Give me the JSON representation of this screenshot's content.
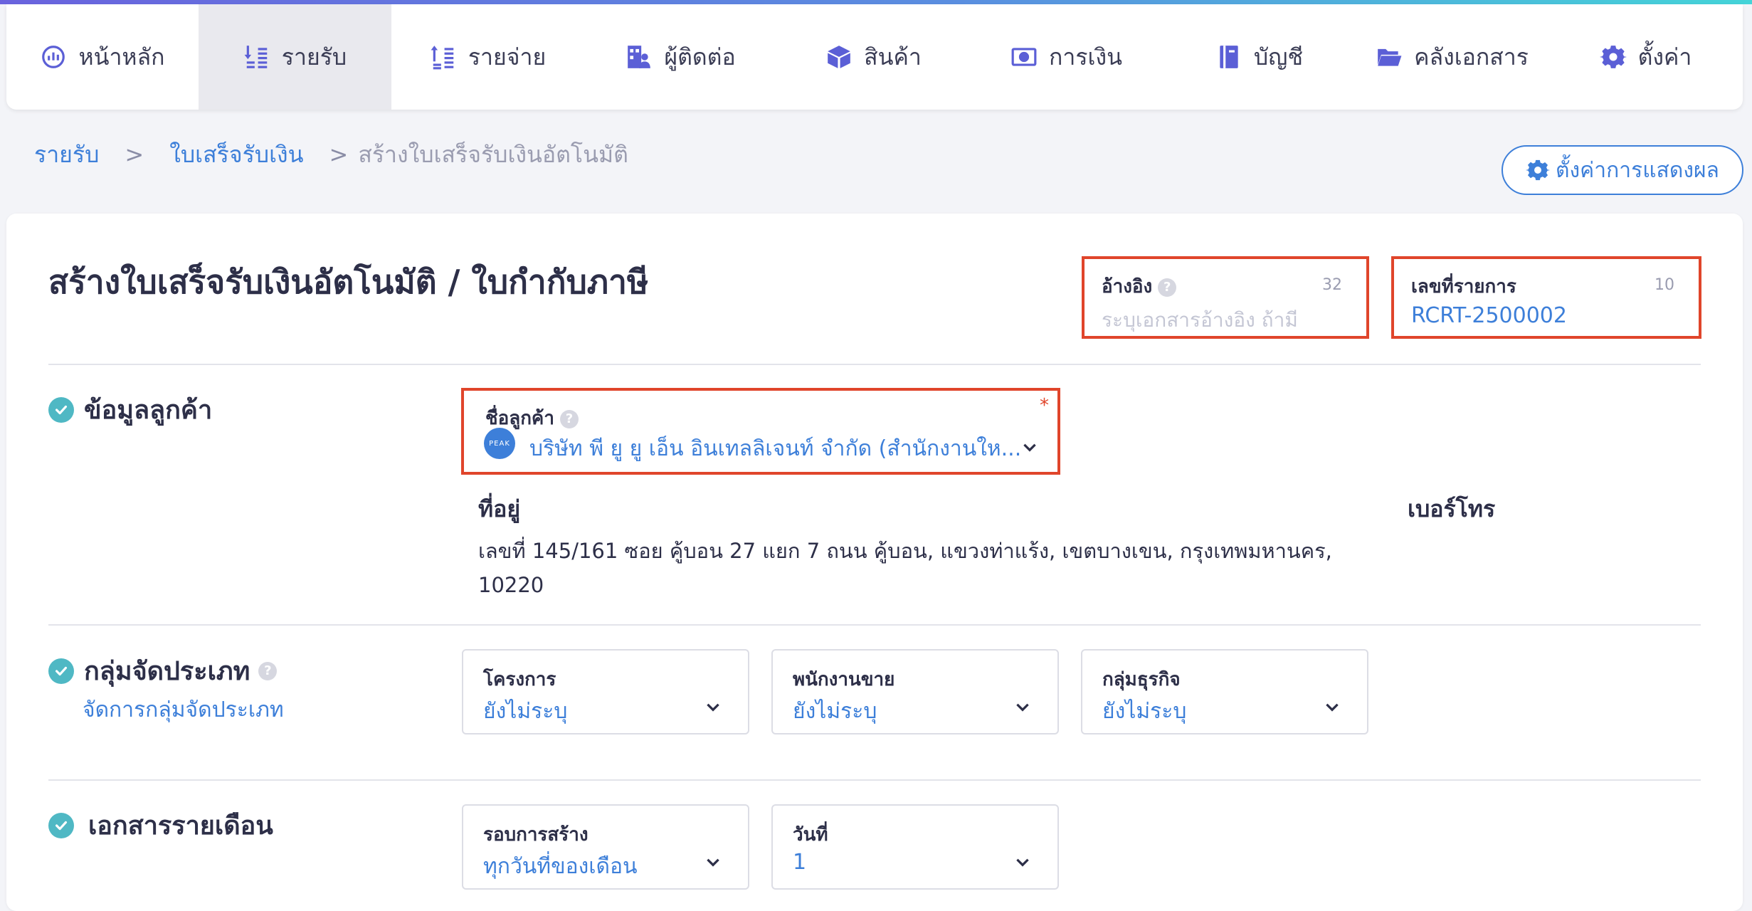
{
  "nav": {
    "items": [
      {
        "label": "หน้าหลัก",
        "icon": "dashboard-icon"
      },
      {
        "label": "รายรับ",
        "icon": "income-icon",
        "active": true
      },
      {
        "label": "รายจ่าย",
        "icon": "expense-icon"
      },
      {
        "label": "ผู้ติดต่อ",
        "icon": "contacts-icon"
      },
      {
        "label": "สินค้า",
        "icon": "product-box-icon"
      },
      {
        "label": "การเงิน",
        "icon": "money-icon"
      },
      {
        "label": "บัญชี",
        "icon": "ledger-book-icon"
      },
      {
        "label": "คลังเอกสาร",
        "icon": "folder-icon"
      },
      {
        "label": "ตั้งค่า",
        "icon": "gear-icon"
      }
    ]
  },
  "breadcrumb": {
    "level1": "รายรับ",
    "sep": ">",
    "level2": "ใบเสร็จรับเงิน",
    "current": "สร้างใบเสร็จรับเงินอัตโนมัติ"
  },
  "display_settings_label": "ตั้งค่าการแสดงผล",
  "page_title": "สร้างใบเสร็จรับเงินอัตโนมัติ / ใบกำกับภาษี",
  "reference": {
    "label": "อ้างอิง",
    "counter": "32",
    "placeholder": "ระบุเอกสารอ้างอิง ถ้ามี"
  },
  "doc_number": {
    "label": "เลขที่รายการ",
    "counter": "10",
    "value": "RCRT-2500002"
  },
  "customer_section": {
    "title": "ข้อมูลลูกค้า",
    "name_label": "ชื่อลูกค้า",
    "required_mark": "*",
    "avatar_text": "PEAK",
    "name_value": "บริษัท พี ยู ยู เอ็น อินเทลลิเจนท์ จำกัด (สำนักงานให...",
    "address_label": "ที่อยู่",
    "address_line1": "เลขที่ 145/161 ซอย คู้บอน 27 แยก 7 ถนน คู้บอน, แขวงท่าแร้ง, เขตบางเขน, กรุงเทพมหานคร,",
    "address_line2": "10220",
    "phone_label": "เบอร์โทร"
  },
  "group_section": {
    "title": "กลุ่มจัดประเภท",
    "manage_link": "จัดการกลุ่มจัดประเภท",
    "fields": [
      {
        "label": "โครงการ",
        "value": "ยังไม่ระบุ"
      },
      {
        "label": "พนักงานขาย",
        "value": "ยังไม่ระบุ"
      },
      {
        "label": "กลุ่มธุรกิจ",
        "value": "ยังไม่ระบุ"
      }
    ]
  },
  "monthly_section": {
    "title": "เอกสารรายเดือน",
    "fields": [
      {
        "label": "รอบการสร้าง",
        "value": "ทุกวันที่ของเดือน"
      },
      {
        "label": "วันที่",
        "value": "1"
      }
    ]
  },
  "colors": {
    "accent": "#3d7fd9",
    "highlight_border": "#e0452b",
    "check": "#4fb8c4",
    "nav_icon": "#5b5fd6"
  }
}
